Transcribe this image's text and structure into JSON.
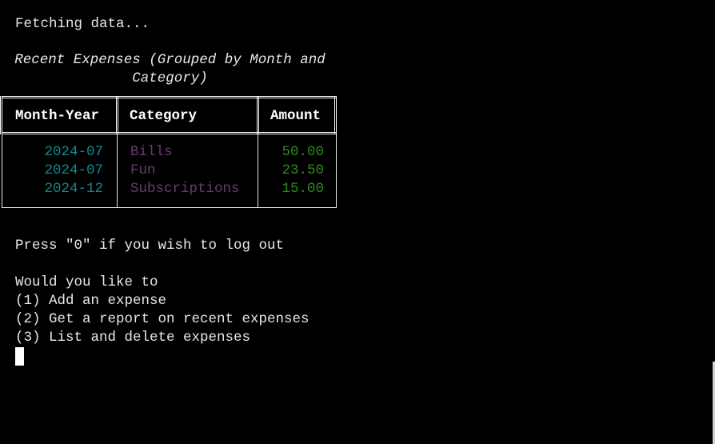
{
  "terminal": {
    "status_line": "Fetching data...",
    "report_title_line1": "Recent Expenses (Grouped by Month and",
    "report_title_line2": "Category)",
    "table": {
      "headers": [
        "Month-Year",
        "Category",
        "Amount"
      ],
      "rows": [
        {
          "month_year": "2024-07",
          "category": "Bills",
          "amount": "50.00"
        },
        {
          "month_year": "2024-07",
          "category": "Fun",
          "amount": "23.50"
        },
        {
          "month_year": "2024-12",
          "category": "Subscriptions",
          "amount": "15.00"
        }
      ]
    },
    "logout_prompt": "Press \"0\" if you wish to log out",
    "menu_prompt": "Would you like to",
    "menu_options": [
      "(1) Add an expense",
      "(2) Get a report on recent expenses",
      "(3) List and delete expenses"
    ]
  },
  "colors": {
    "background": "#000000",
    "text": "#e8e8e8",
    "month_year": "#138a8a",
    "category": "#6a3a73",
    "amount": "#2e8b1e"
  }
}
